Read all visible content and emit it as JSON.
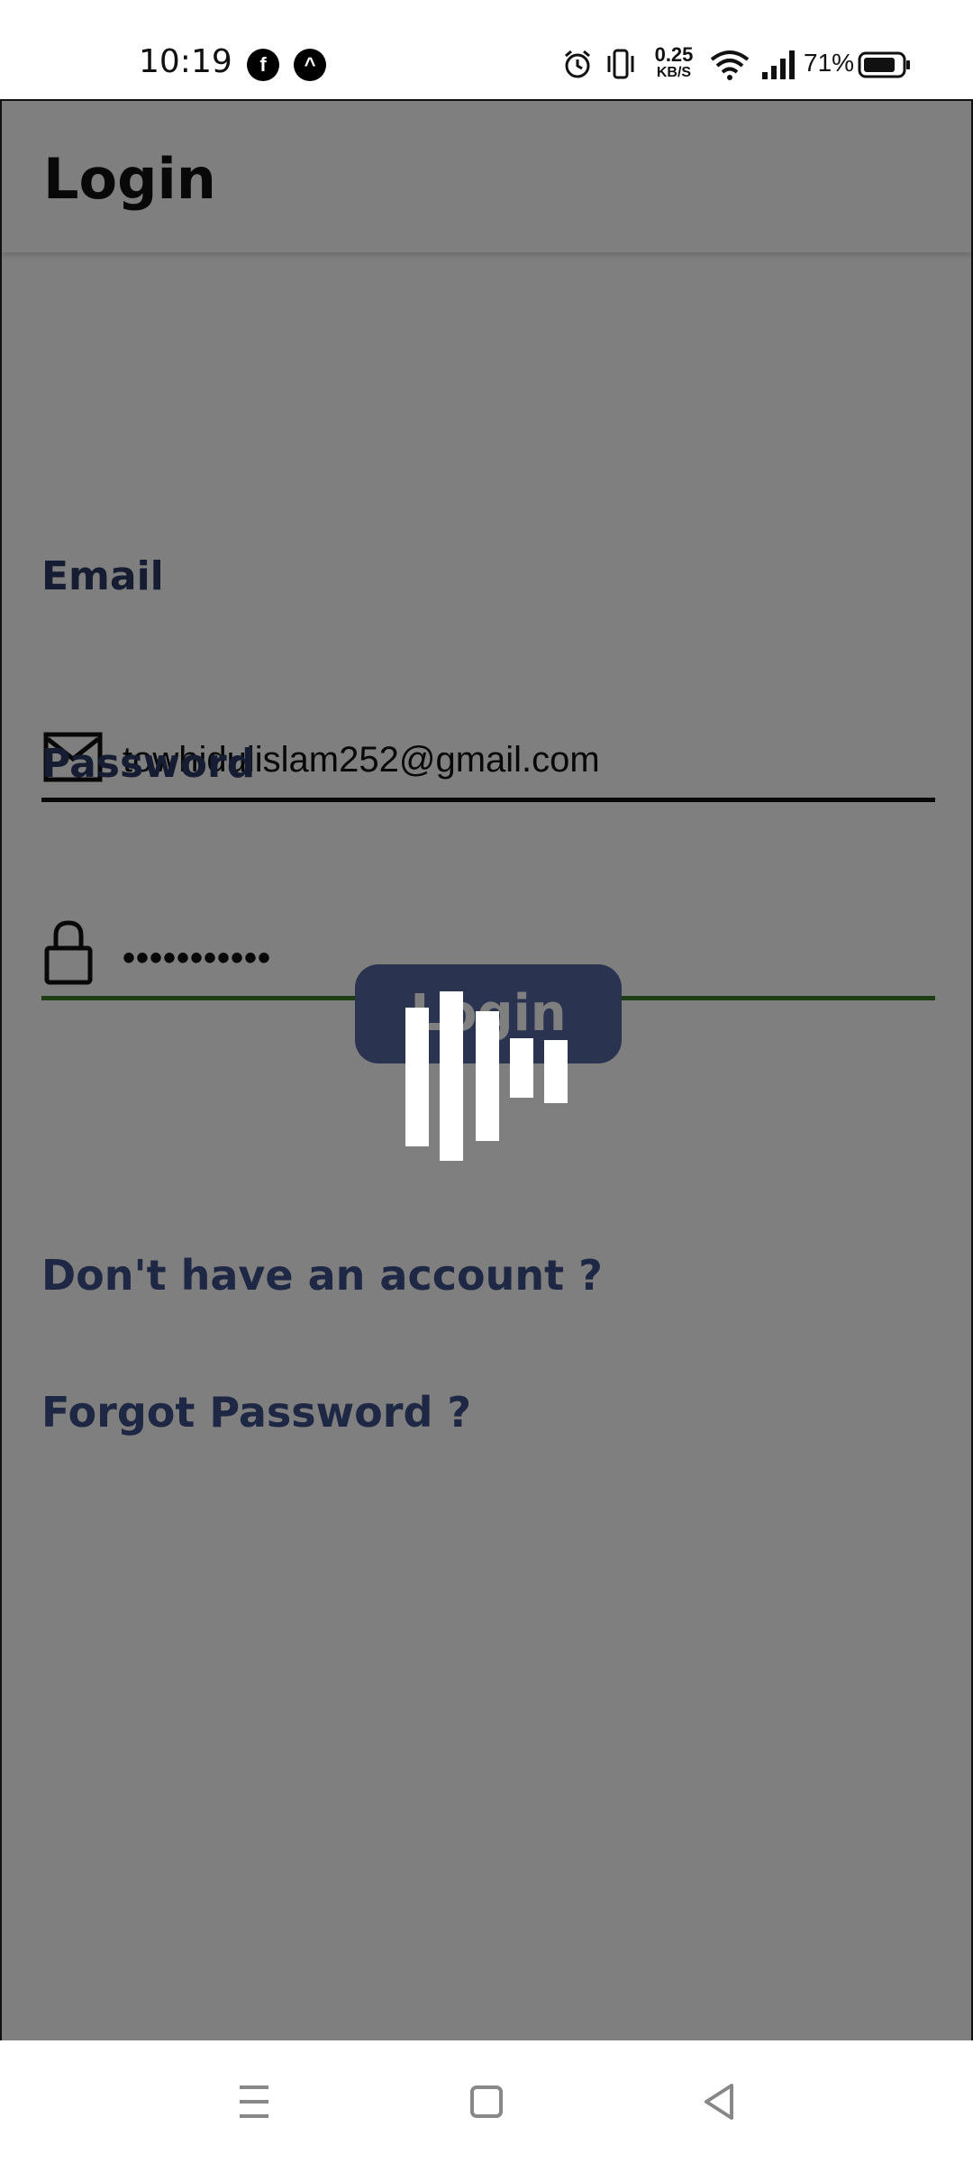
{
  "status_bar": {
    "time": "10:19",
    "app_icons": [
      "facebook-icon",
      "app-notification-icon"
    ],
    "network_speed_value": "0.25",
    "network_speed_unit": "KB/S",
    "battery_percent": "71%",
    "icons": [
      "alarm-icon",
      "vibrate-icon",
      "wifi-icon",
      "signal-icon",
      "battery-icon"
    ]
  },
  "app_bar": {
    "title": "Login"
  },
  "form": {
    "email_label": "Email",
    "email_value": "towhidulislam252@gmail.com",
    "email_icon": "mail-icon",
    "password_label": "Password",
    "password_value": "•••••••••••",
    "password_icon": "lock-icon",
    "login_button_label": "Login"
  },
  "links": {
    "signup": "Don't have an account ?",
    "forgot_password": "Forgot Password ?"
  },
  "loading": {
    "visible": true,
    "icon": "loading-bars-icon"
  },
  "nav_bar": {
    "buttons": [
      "menu-icon",
      "home-icon",
      "back-icon"
    ]
  },
  "colors": {
    "label": "#2d3a66",
    "button": "#54679f",
    "password_underline": "#3b7a26",
    "email_underline": "#111111",
    "overlay": "rgba(0,0,0,0.5)"
  }
}
